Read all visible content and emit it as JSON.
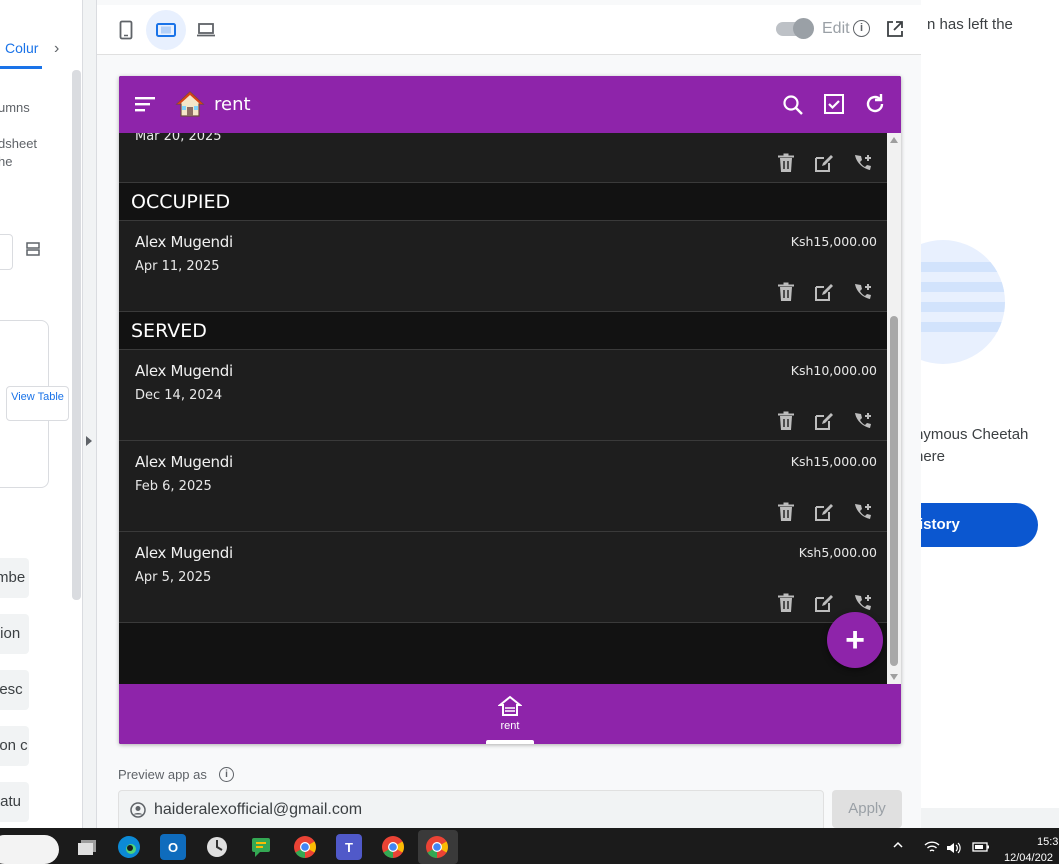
{
  "left_panel": {
    "tab_label": "Colur",
    "texts": [
      "umns",
      "dsheet",
      "he"
    ],
    "view_table_label": "View Table",
    "chips": [
      "mbe",
      "tion",
      "lesc",
      "ion c",
      "tatu"
    ]
  },
  "preview_toolbar": {
    "edit_label": "Edit"
  },
  "app": {
    "title": "rent",
    "partial_record_date": "Mar 20, 2025",
    "groups": [
      {
        "label": "OCCUPIED",
        "records": [
          {
            "name": "Alex Mugendi",
            "date": "Apr 11, 2025",
            "amount": "Ksh15,000.00"
          }
        ]
      },
      {
        "label": "SERVED",
        "records": [
          {
            "name": "Alex Mugendi",
            "date": "Dec 14, 2024",
            "amount": "Ksh10,000.00"
          },
          {
            "name": "Alex Mugendi",
            "date": "Feb 6, 2025",
            "amount": "Ksh15,000.00"
          },
          {
            "name": "Alex Mugendi",
            "date": "Apr 5, 2025",
            "amount": "Ksh5,000.00"
          }
        ]
      }
    ],
    "fab_symbol": "+",
    "bottom_nav_label": "rent",
    "accent_color": "#8e24aa"
  },
  "preview_as": {
    "label": "Preview app as",
    "email": "haideralexofficial@gmail.com",
    "apply_label": "Apply"
  },
  "right_panel": {
    "message": "n has left the",
    "name_line1": "nymous Cheetah",
    "name_line2": "here",
    "history_button": "istory"
  },
  "taskbar": {
    "time": "15:3",
    "date": "12/04/202"
  }
}
